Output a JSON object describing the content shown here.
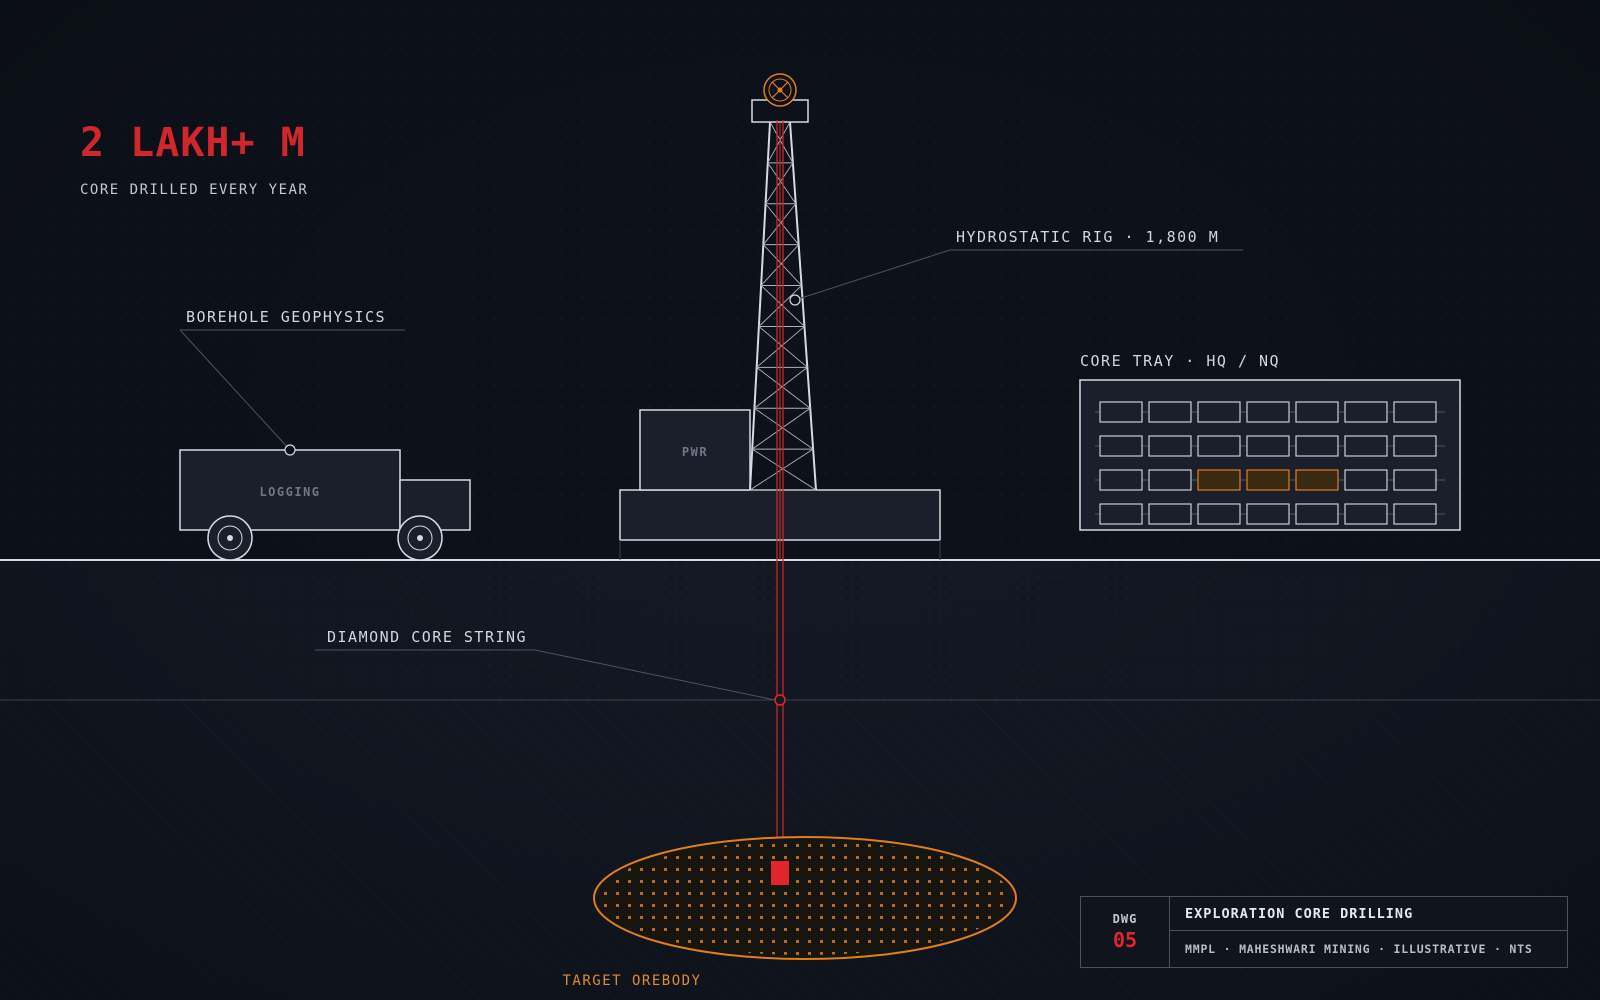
{
  "headline": {
    "stat": "2 LAKH+ M",
    "caption": "CORE DRILLED EVERY YEAR"
  },
  "labels": {
    "borehole_geophysics": "BOREHOLE GEOPHYSICS",
    "logging": "LOGGING",
    "pwr": "PWR",
    "rig": "HYDROSTATIC RIG · 1,800 M",
    "core_tray": "CORE TRAY · HQ / NQ",
    "core_string": "DIAMOND CORE STRING",
    "orebody": "TARGET OREBODY"
  },
  "title_block": {
    "dwg_label": "DWG",
    "dwg_number": "05",
    "title": "EXPLORATION CORE DRILLING",
    "meta": "MMPL · MAHESHWARI MINING · ILLUSTRATIVE · NTS"
  },
  "colors": {
    "background": "#0d1119",
    "line": "#d6d9e0",
    "accent_red": "#e0262c",
    "accent_orange": "#e07f1e",
    "muted_text": "#c3c8d2"
  },
  "icons": {
    "crown_block": "crown-wheel-icon",
    "wheel": "truck-wheel-icon"
  }
}
